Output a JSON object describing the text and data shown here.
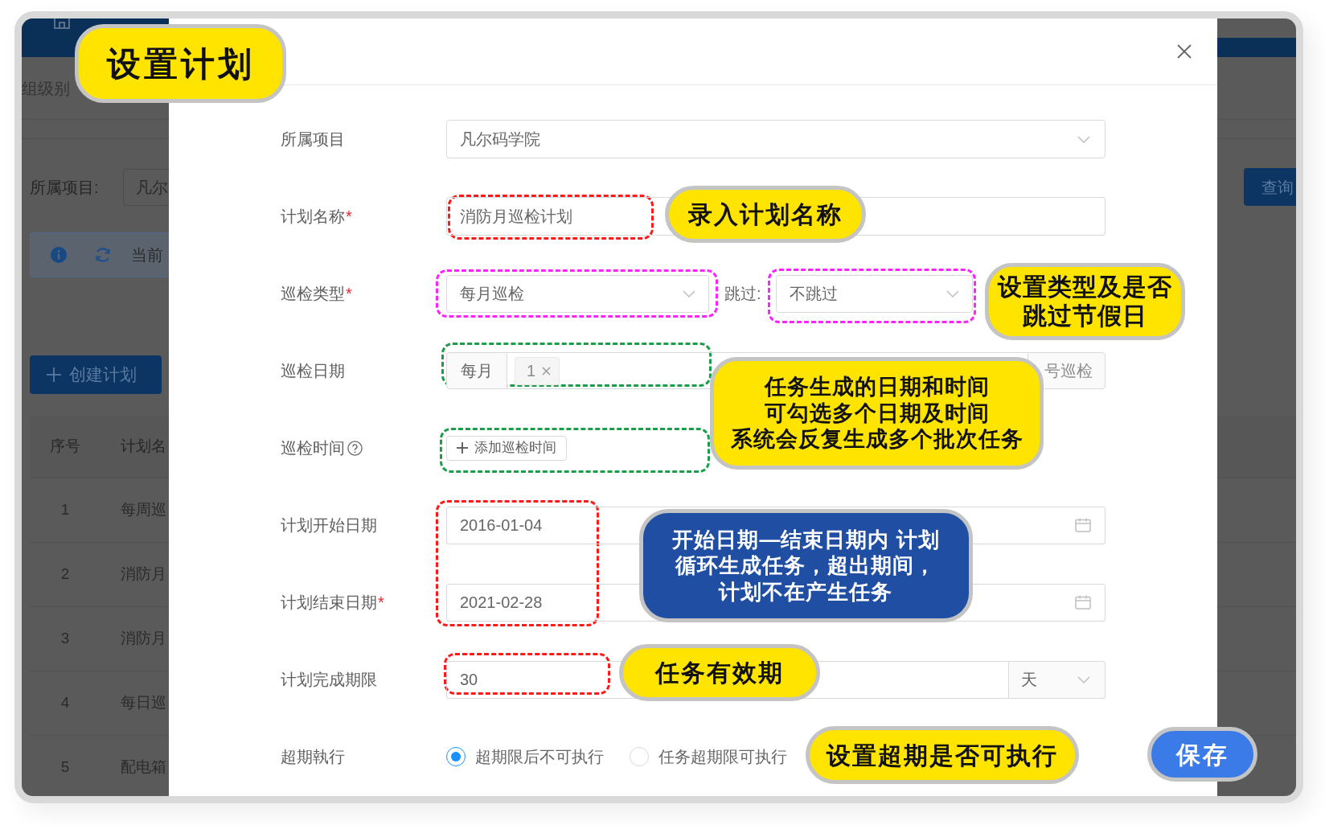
{
  "background": {
    "breadcrumb": "组级别",
    "filter_label": "所属项目:",
    "filter_value": "凡尔",
    "notice": "当前",
    "create_button": "创建计划",
    "query_button": "查询",
    "table": {
      "columns": [
        "序号",
        "计划名"
      ],
      "rows": [
        [
          "1",
          "每周巡"
        ],
        [
          "2",
          "消防月"
        ],
        [
          "3",
          "消防月"
        ],
        [
          "4",
          "每日巡"
        ],
        [
          "5",
          "配电箱"
        ]
      ]
    }
  },
  "dialog": {
    "fields": [
      {
        "kind": "select",
        "label": "所属项目",
        "value": "凡尔码学院"
      },
      {
        "kind": "text",
        "label": "计划名称",
        "required_mark": "*",
        "value": "消防月巡检计划"
      },
      {
        "kind": "select_pair",
        "label": "巡检类型",
        "required_mark": "*",
        "value": "每月巡检",
        "second_label": "跳过:",
        "second_value": "不跳过"
      },
      {
        "kind": "tag_input",
        "label": "巡检日期",
        "prefix": "每月",
        "tags": [
          "1"
        ],
        "suffix": "号巡检"
      },
      {
        "kind": "add_button",
        "label": "巡检时间",
        "help": true,
        "button": "添加巡检时间"
      },
      {
        "kind": "date",
        "label": "计划开始日期",
        "value": "2016-01-04"
      },
      {
        "kind": "date",
        "label": "计划结束日期",
        "required_mark": "*",
        "value": "2021-02-28"
      },
      {
        "kind": "unit_input",
        "label": "计划完成期限",
        "value": "30",
        "unit": "天"
      },
      {
        "kind": "radio",
        "label": "超期執行",
        "options": [
          {
            "label": "超期限后不可执行",
            "selected": true
          },
          {
            "label": "任务超期限可执行",
            "selected": false
          }
        ]
      }
    ]
  },
  "annotations": [
    {
      "kind": "callout",
      "color": "#ffe400",
      "lines": [
        "设置计划"
      ]
    },
    {
      "kind": "frame",
      "color": "#ff1a1a"
    },
    {
      "kind": "callout",
      "color": "#ffe400",
      "lines": [
        "录入计划名称"
      ]
    },
    {
      "kind": "frame",
      "color": "#ff22ff"
    },
    {
      "kind": "frame",
      "color": "#ff22ff"
    },
    {
      "kind": "callout",
      "color": "#ffe400",
      "lines": [
        "设置类型及是否",
        "跳过节假日"
      ]
    },
    {
      "kind": "frame",
      "color": "#1a9e4a"
    },
    {
      "kind": "frame",
      "color": "#1a9e4a"
    },
    {
      "kind": "callout",
      "color": "#ffe400",
      "lines": [
        "任务生成的日期和时间",
        "可勾选多个日期及时间",
        "系统会反复生成多个批次任务"
      ]
    },
    {
      "kind": "frame",
      "color": "#ff1a1a"
    },
    {
      "kind": "callout",
      "color": "#1f4ea3",
      "lines": [
        "开始日期—结束日期内 计划",
        "循环生成任务，超出期间，",
        "计划不在产生任务"
      ]
    },
    {
      "kind": "frame",
      "color": "#ff1a1a"
    },
    {
      "kind": "callout",
      "color": "#ffe400",
      "lines": [
        "任务有效期"
      ]
    },
    {
      "kind": "callout",
      "color": "#ffe400",
      "lines": [
        "设置超期是否可执行"
      ]
    }
  ],
  "save_button": {
    "label": "保存"
  }
}
